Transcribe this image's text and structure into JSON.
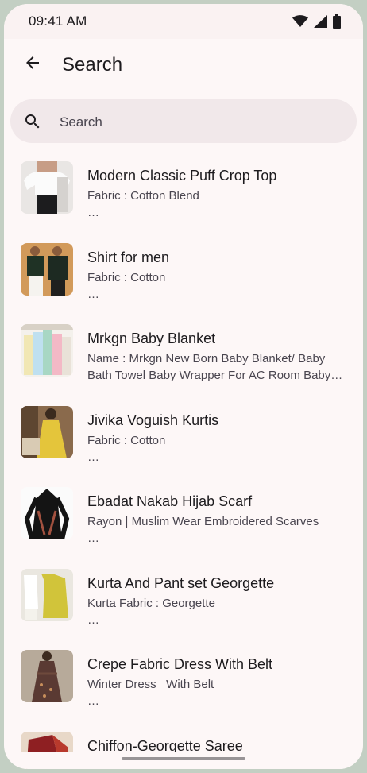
{
  "status_bar": {
    "time": "09:41 AM",
    "icons": [
      "wifi-icon",
      "signal-icon",
      "battery-icon"
    ]
  },
  "app_bar": {
    "back_icon": "arrow-back-icon",
    "title": "Search"
  },
  "search": {
    "icon": "search-icon",
    "placeholder": "Search",
    "value": ""
  },
  "results": [
    {
      "title": "Modern Classic Puff Crop Top",
      "description": "Fabric : Cotton Blend\n…",
      "thumb": "white-top-photo"
    },
    {
      "title": "Shirt for men",
      "description": "Fabric : Cotton\n…",
      "thumb": "men-shirt-photo"
    },
    {
      "title": "Mrkgn Baby Blanket",
      "description": "Name : Mrkgn New Born Baby Blanket/ Baby Bath Towel Baby Wrapper For AC Room Baby Blanket",
      "thumb": "baby-blanket-photo"
    },
    {
      "title": "Jivika Voguish Kurtis",
      "description": "Fabric : Cotton\n…",
      "thumb": "yellow-kurti-photo"
    },
    {
      "title": "Ebadat Nakab Hijab Scarf",
      "description": "Rayon | Muslim Wear Embroidered Scarves\n…",
      "thumb": "hijab-scarf-photo"
    },
    {
      "title": "Kurta And Pant set Georgette",
      "description": "Kurta Fabric : Georgette\n…",
      "thumb": "kurta-set-photo"
    },
    {
      "title": "Crepe Fabric Dress With Belt",
      "description": "Winter Dress _With Belt\n…",
      "thumb": "crepe-dress-photo"
    },
    {
      "title": "Chiffon-Georgette Saree",
      "description": "",
      "thumb": "saree-photo"
    }
  ],
  "colors": {
    "background": "#fdf7f7",
    "search_bar": "#f1e8ea",
    "text_primary": "#1d1b1e",
    "text_secondary": "#49454f",
    "frame": "#c3cfc3"
  }
}
